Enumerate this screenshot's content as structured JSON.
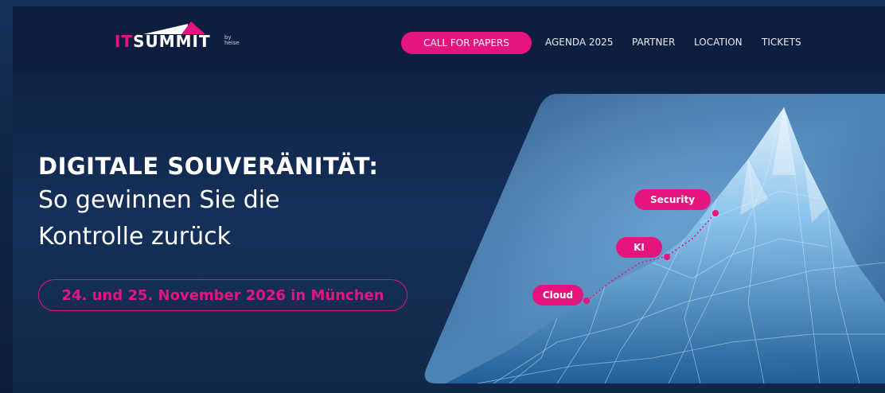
{
  "brand": {
    "logo_it": "IT",
    "logo_summit": "SUMMIT",
    "logo_by_line1": "by",
    "logo_by_line2": "heise",
    "accent_color": "#e6147f",
    "nav_bg_color": "#0e1e3f"
  },
  "nav": {
    "cta": "CALL FOR PAPERS",
    "links": [
      "AGENDA 2025",
      "PARTNER",
      "LOCATION",
      "TICKETS"
    ]
  },
  "hero": {
    "headline": "DIGITALE SOUVERÄNITÄT:",
    "subline_1": "So gewinnen Sie die",
    "subline_2": "Kontrolle zurück",
    "date_pill": "24. und 25. November 2026 in München"
  },
  "mountain_tags": [
    "Security",
    "KI",
    "Cloud"
  ]
}
